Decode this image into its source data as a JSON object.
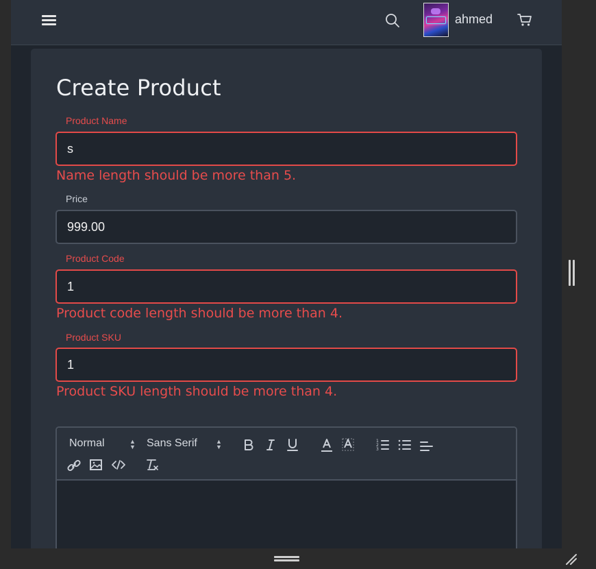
{
  "header": {
    "username": "ahmed",
    "menu_icon": "hamburger-icon",
    "search_icon": "search-icon",
    "cart_icon": "cart-icon",
    "avatar_icon": "gamer-avatar"
  },
  "page": {
    "title": "Create Product"
  },
  "form": {
    "product_name": {
      "label": "Product Name",
      "value": "s",
      "error": "Name length should be more than 5."
    },
    "price": {
      "label": "Price",
      "value": "999.00"
    },
    "product_code": {
      "label": "Product Code",
      "value": "1",
      "error": "Product code length should be more than 4."
    },
    "product_sku": {
      "label": "Product SKU",
      "value": "1",
      "error": "Product SKU length should be more than 4."
    }
  },
  "editor": {
    "heading_select": "Normal",
    "font_select": "Sans Serif",
    "toolbar_buttons": [
      "bold",
      "italic",
      "underline",
      "font-color",
      "background-color",
      "ordered-list",
      "bullet-list",
      "align",
      "link",
      "image",
      "code-block",
      "clean-format"
    ],
    "content": ""
  },
  "colors": {
    "background": "#1f252d",
    "card": "#2b323c",
    "error": "#e74c4c",
    "text": "#eef0f3"
  }
}
